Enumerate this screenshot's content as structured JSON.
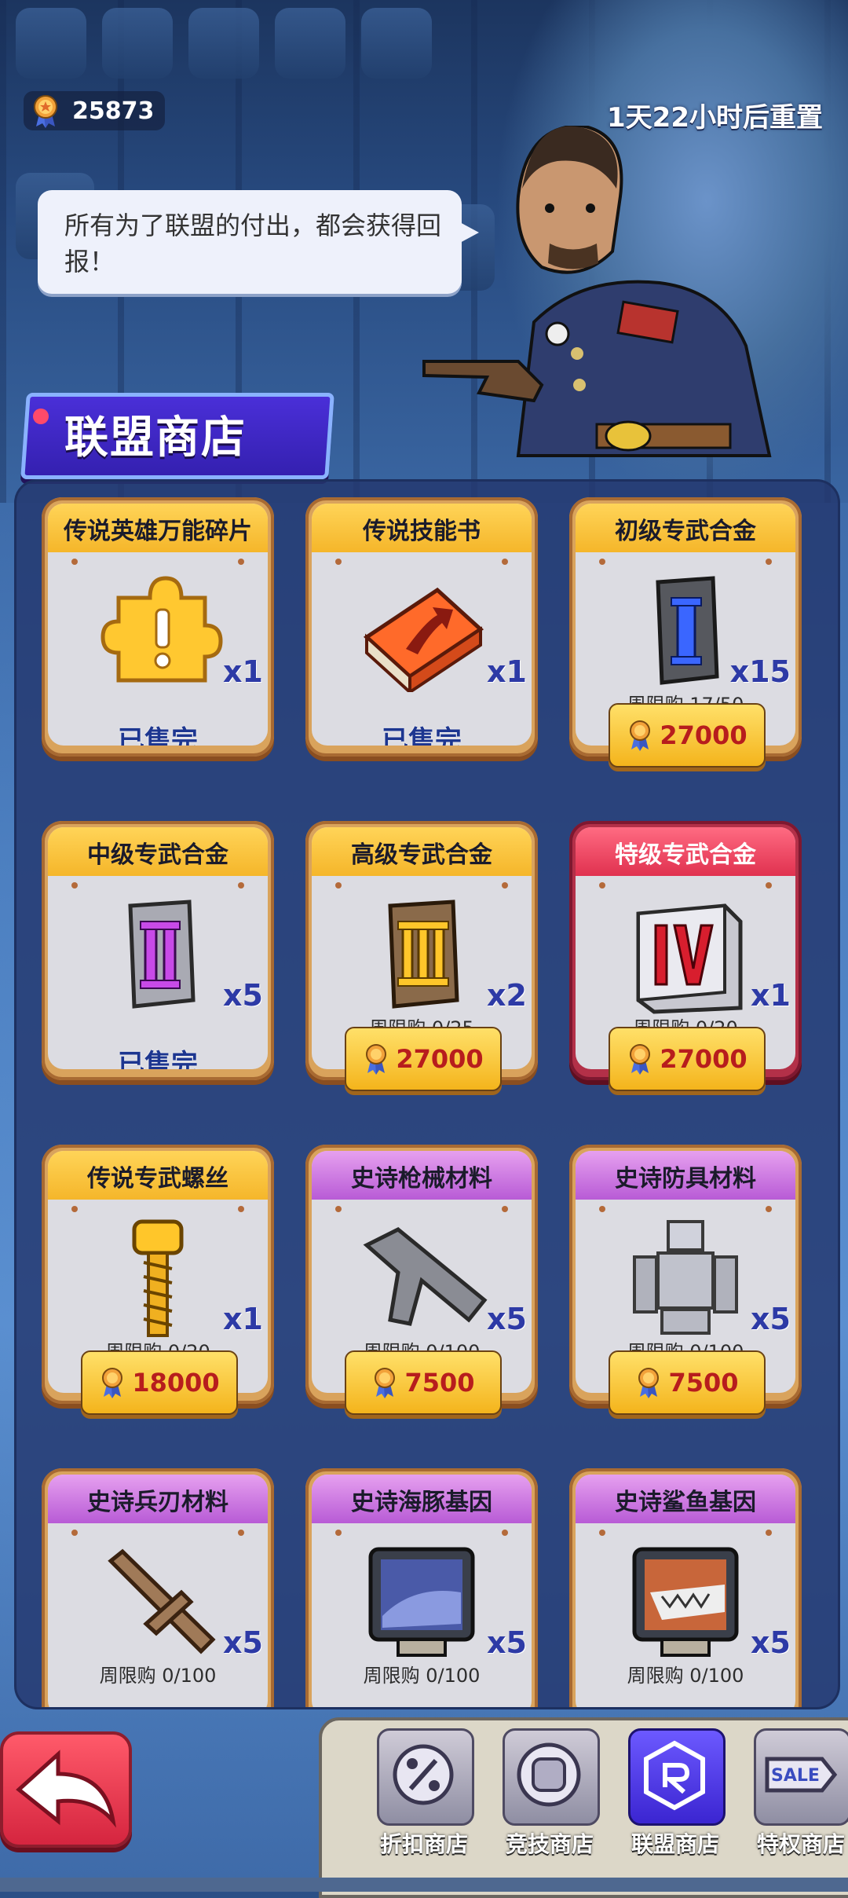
{
  "header": {
    "currency_value": "25873",
    "reset_text": "1天22小时后重置"
  },
  "npc": {
    "speech": "所有为了联盟的付出，都会获得回报！"
  },
  "shop": {
    "title": "联盟商店",
    "items": [
      {
        "name": "传说英雄万能碎片",
        "qty": "x1",
        "limit": "",
        "price": "",
        "status": "已售完",
        "rarity": "legend",
        "icon": "puzzle-piece-icon"
      },
      {
        "name": "传说技能书",
        "qty": "x1",
        "limit": "",
        "price": "",
        "status": "已售完",
        "rarity": "legend",
        "icon": "skill-book-icon"
      },
      {
        "name": "初级专武合金",
        "qty": "x15",
        "limit": "周限购 17/50",
        "price": "27000",
        "status": "",
        "rarity": "legend",
        "icon": "alloy-i-icon"
      },
      {
        "name": "中级专武合金",
        "qty": "x5",
        "limit": "",
        "price": "",
        "status": "已售完",
        "rarity": "legend",
        "icon": "alloy-ii-icon"
      },
      {
        "name": "高级专武合金",
        "qty": "x2",
        "limit": "周限购 0/25",
        "price": "27000",
        "status": "",
        "rarity": "legend",
        "icon": "alloy-iii-icon"
      },
      {
        "name": "特级专武合金",
        "qty": "x1",
        "limit": "周限购 0/20",
        "price": "27000",
        "status": "",
        "rarity": "red",
        "icon": "alloy-iv-icon"
      },
      {
        "name": "传说专武螺丝",
        "qty": "x1",
        "limit": "周限购 0/20",
        "price": "18000",
        "status": "",
        "rarity": "legend",
        "icon": "screw-icon"
      },
      {
        "name": "史诗枪械材料",
        "qty": "x5",
        "limit": "周限购 0/100",
        "price": "7500",
        "status": "",
        "rarity": "epic",
        "icon": "gun-material-icon"
      },
      {
        "name": "史诗防具材料",
        "qty": "x5",
        "limit": "周限购 0/100",
        "price": "7500",
        "status": "",
        "rarity": "epic",
        "icon": "armor-material-icon"
      },
      {
        "name": "史诗兵刃材料",
        "qty": "x5",
        "limit": "周限购 0/100",
        "price": "",
        "status": "",
        "rarity": "epic",
        "icon": "blade-material-icon"
      },
      {
        "name": "史诗海豚基因",
        "qty": "x5",
        "limit": "周限购 0/100",
        "price": "",
        "status": "",
        "rarity": "epic",
        "icon": "dolphin-gene-icon"
      },
      {
        "name": "史诗鲨鱼基因",
        "qty": "x5",
        "limit": "周限购 0/100",
        "price": "",
        "status": "",
        "rarity": "epic",
        "icon": "shark-gene-icon"
      }
    ]
  },
  "tabs": [
    {
      "label": "折扣商店",
      "icon": "discount-icon",
      "active": false
    },
    {
      "label": "竞技商店",
      "icon": "fist-icon",
      "active": false
    },
    {
      "label": "联盟商店",
      "icon": "alliance-icon",
      "active": true
    },
    {
      "label": "特权商店",
      "icon": "sale-icon",
      "active": false
    }
  ],
  "tab_icon_text": {
    "sale": "SALE"
  },
  "colors": {
    "price_text": "#b71d1d",
    "qty_text": "#2d3aa6",
    "soldout_text": "#1d3690"
  }
}
